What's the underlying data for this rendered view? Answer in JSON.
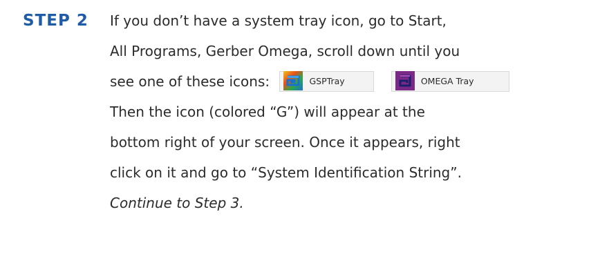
{
  "step": {
    "label": "STEP 2",
    "lines": {
      "l1": "If you don’t have a system tray icon, go to Start,",
      "l2": "All Programs, Gerber Omega, scroll down until you",
      "l3_prefix": "see one of these icons:",
      "l4": "Then the icon (colored “G”) will appear at the",
      "l5": "bottom right of your screen. Once it appears, right",
      "l6": "click on it and go to “System Identification String”.",
      "l7": "Continue to Step 3."
    }
  },
  "icons": {
    "gsp_tray": {
      "label": "GSPTray",
      "icon": "gsp-tray-icon"
    },
    "omega_tray": {
      "label": "OMEGA Tray",
      "icon": "omega-tray-icon"
    }
  },
  "colors": {
    "step_label": "#1f5ca8",
    "body_text": "#2b2b2b",
    "omega_purple": "#7a2a86"
  }
}
